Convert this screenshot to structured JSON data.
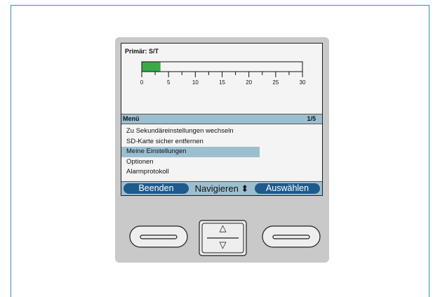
{
  "screen": {
    "primary_title": "Primär: S/T",
    "scale": {
      "min": 0,
      "max": 30,
      "major_ticks": [
        "0",
        "5",
        "10",
        "15",
        "20",
        "25",
        "30"
      ],
      "fill_value": 3.5,
      "fill_color": "#3aaa46"
    },
    "menu": {
      "title": "Menü",
      "page": "1/5",
      "items": [
        {
          "label": "Zu Sekundäreinstellungen wechseln"
        },
        {
          "label": "SD-Karte sicher entfernen"
        },
        {
          "label": "Meine Einstellungen",
          "selected": true
        },
        {
          "label": "Optionen"
        },
        {
          "label": "Alarmprotokoll"
        }
      ]
    },
    "softkeys": {
      "left": "Beenden",
      "middle": "Navigieren ⬍",
      "right": "Auswählen"
    }
  },
  "hardware": {
    "up_arrow": "△",
    "down_arrow": "▽"
  },
  "colors": {
    "frame_border": "#2f8fc6",
    "device_body": "#c9c9c9",
    "header_bg": "#9cbfd0",
    "pill_bg": "#1e5a8c"
  }
}
